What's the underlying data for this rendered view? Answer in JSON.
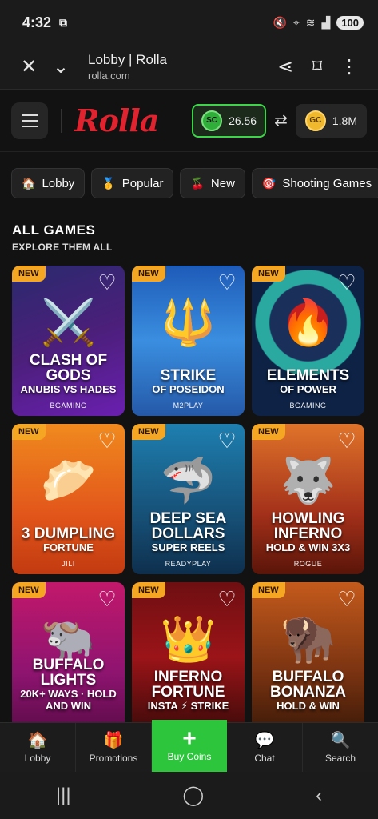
{
  "status": {
    "time": "4:32",
    "battery": "100"
  },
  "browser": {
    "title": "Lobby | Rolla",
    "host": "rolla.com"
  },
  "header": {
    "logo": "Rolla",
    "sc_label": "SC",
    "sc_balance": "26.56",
    "gc_label": "GC",
    "gc_balance": "1.8M"
  },
  "chips": [
    {
      "label": "Lobby",
      "icon": "🏠"
    },
    {
      "label": "Popular",
      "icon": "🥇"
    },
    {
      "label": "New",
      "icon": "🍒"
    },
    {
      "label": "Shooting Games",
      "icon": "🎯"
    }
  ],
  "section": {
    "title": "ALL GAMES",
    "subtitle": "EXPLORE THEM ALL"
  },
  "games": [
    {
      "badge": "NEW",
      "title": "Clash of Gods",
      "sub": "Anubis vs Hades",
      "provider": "BGAMING",
      "art": "⚔️"
    },
    {
      "badge": "NEW",
      "title": "Strike",
      "sub": "of Poseidon",
      "provider": "M2PLAY",
      "art": "🔱"
    },
    {
      "badge": "NEW",
      "title": "Elements",
      "sub": "of Power",
      "provider": "BGAMING",
      "art": "🔥"
    },
    {
      "badge": "NEW",
      "title": "3 Dumpling",
      "sub": "Fortune",
      "provider": "JILI",
      "art": "🥟"
    },
    {
      "badge": "NEW",
      "title": "Deep Sea Dollars",
      "sub": "Super Reels",
      "provider": "READYPLAY",
      "art": "🦈"
    },
    {
      "badge": "NEW",
      "title": "Howling Inferno",
      "sub": "Hold & Win 3x3",
      "provider": "ROGUE",
      "art": "🐺"
    },
    {
      "badge": "NEW",
      "title": "Buffalo Lights",
      "sub": "20K+ Ways · Hold and Win",
      "provider": "",
      "art": "🐃"
    },
    {
      "badge": "NEW",
      "title": "Inferno Fortune",
      "sub": "Insta ⚡ Strike",
      "provider": "",
      "art": "👑"
    },
    {
      "badge": "NEW",
      "title": "Buffalo Bonanza",
      "sub": "Hold & Win",
      "provider": "",
      "art": "🦬"
    }
  ],
  "nav": {
    "lobby": "Lobby",
    "promotions": "Promotions",
    "buy": "Buy Coins",
    "chat": "Chat",
    "search": "Search"
  }
}
